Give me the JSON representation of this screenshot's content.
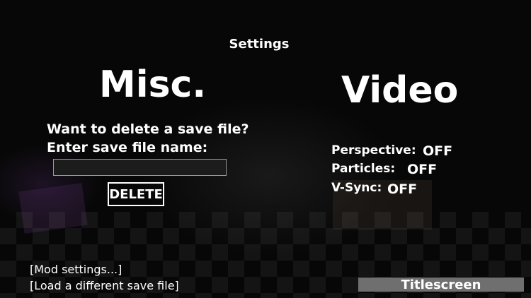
{
  "header": {
    "title": "Settings"
  },
  "misc": {
    "heading": "Misc.",
    "delete_question": "Want to delete a save file?",
    "enter_prompt": "Enter save file name:",
    "save_name_value": "",
    "delete_button": "DELETE"
  },
  "video": {
    "heading": "Video",
    "options": [
      {
        "label": "Perspective:",
        "value": "OFF"
      },
      {
        "label": "Particles:",
        "value": "OFF"
      },
      {
        "label": "V-Sync:",
        "value": "OFF"
      }
    ]
  },
  "footer": {
    "mod_settings": "[Mod settings...]",
    "load_save": "[Load a different save file]",
    "titlescreen": "Titlescreen"
  }
}
